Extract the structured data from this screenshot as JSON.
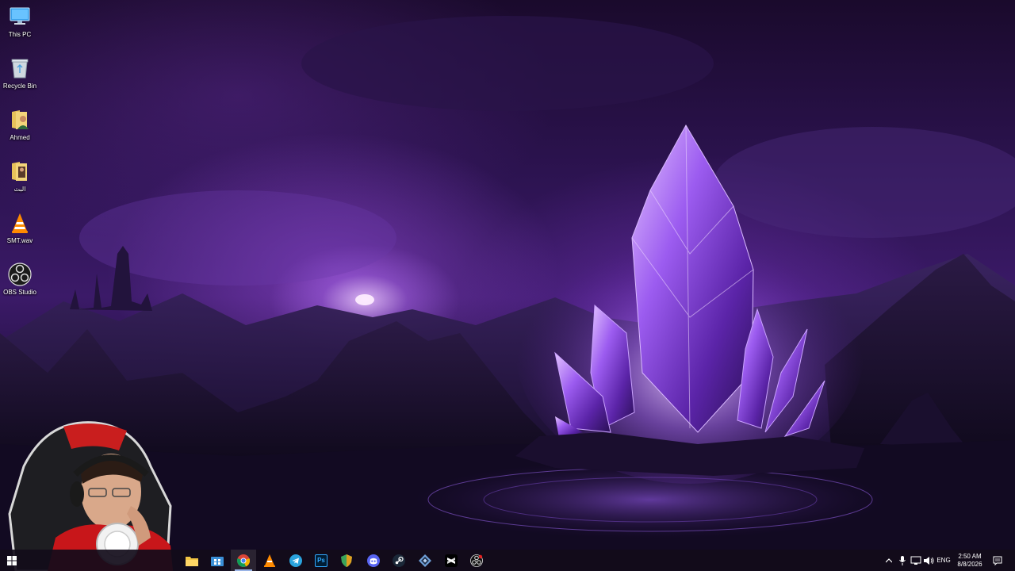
{
  "desktop_icons": [
    {
      "label": "This PC",
      "icon": "this-pc-icon"
    },
    {
      "label": "Recycle Bin",
      "icon": "recycle-bin-icon"
    },
    {
      "label": "Ahmed",
      "icon": "user-folder-icon"
    },
    {
      "label": "البث",
      "icon": "folder-icon"
    },
    {
      "label": "SMT.wav",
      "icon": "vlc-icon"
    },
    {
      "label": "OBS Studio",
      "icon": "obs-icon"
    }
  ],
  "taskbar": {
    "apps": [
      {
        "name": "file-explorer",
        "icon": "folder-icon"
      },
      {
        "name": "store",
        "icon": "store-icon"
      },
      {
        "name": "chrome",
        "icon": "chrome-icon",
        "active": true
      },
      {
        "name": "vlc",
        "icon": "vlc-icon"
      },
      {
        "name": "telegram",
        "icon": "telegram-icon"
      },
      {
        "name": "photoshop",
        "icon": "photoshop-icon",
        "text": "Ps"
      },
      {
        "name": "shield-app",
        "icon": "shield-icon"
      },
      {
        "name": "discord",
        "icon": "discord-icon"
      },
      {
        "name": "steam",
        "icon": "steam-icon"
      },
      {
        "name": "vpn-app",
        "icon": "diamond-app-icon"
      },
      {
        "name": "capcut",
        "icon": "capcut-icon"
      },
      {
        "name": "obs",
        "icon": "obs-icon"
      }
    ],
    "tray": {
      "language": "ENG",
      "time": "2:50 AM",
      "date": "8/8/2026"
    }
  },
  "colors": {
    "taskbar_bg": "#120c1a",
    "accent": "#9ab4e6",
    "wallpaper_primary": "#3b1a68",
    "crystal": "#b87cff"
  }
}
